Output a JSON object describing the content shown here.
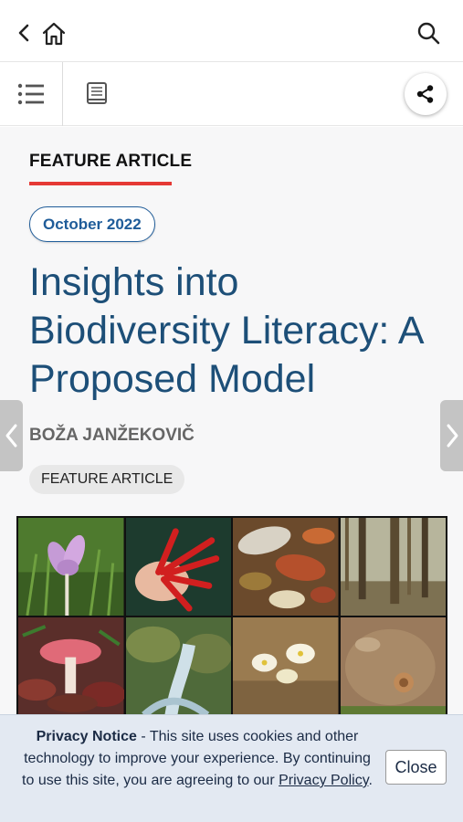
{
  "nav": {
    "back_icon": "chevron-left-icon",
    "home_icon": "home-icon",
    "search_icon": "search-icon"
  },
  "toolbar": {
    "toc_icon": "list-icon",
    "book_icon": "book-icon",
    "share_icon": "share-icon"
  },
  "article": {
    "kicker": "FEATURE ARTICLE",
    "date": "October 2022",
    "title": "Insights into Biodiversity Literacy: A Proposed Model",
    "author": "BOŽA JANŽEKOVIČ",
    "tag": "FEATURE ARTICLE"
  },
  "colors": {
    "accent_red": "#e53935",
    "title_blue": "#1d4f78",
    "pill_blue": "#1f5c99"
  },
  "privacy": {
    "heading": "Privacy Notice",
    "text_before": " - This site uses cookies and other technology to improve your experience. By continuing to use this site, you are agreeing to our ",
    "link": "Privacy Policy",
    "text_after": ".",
    "close_label": "Close"
  }
}
